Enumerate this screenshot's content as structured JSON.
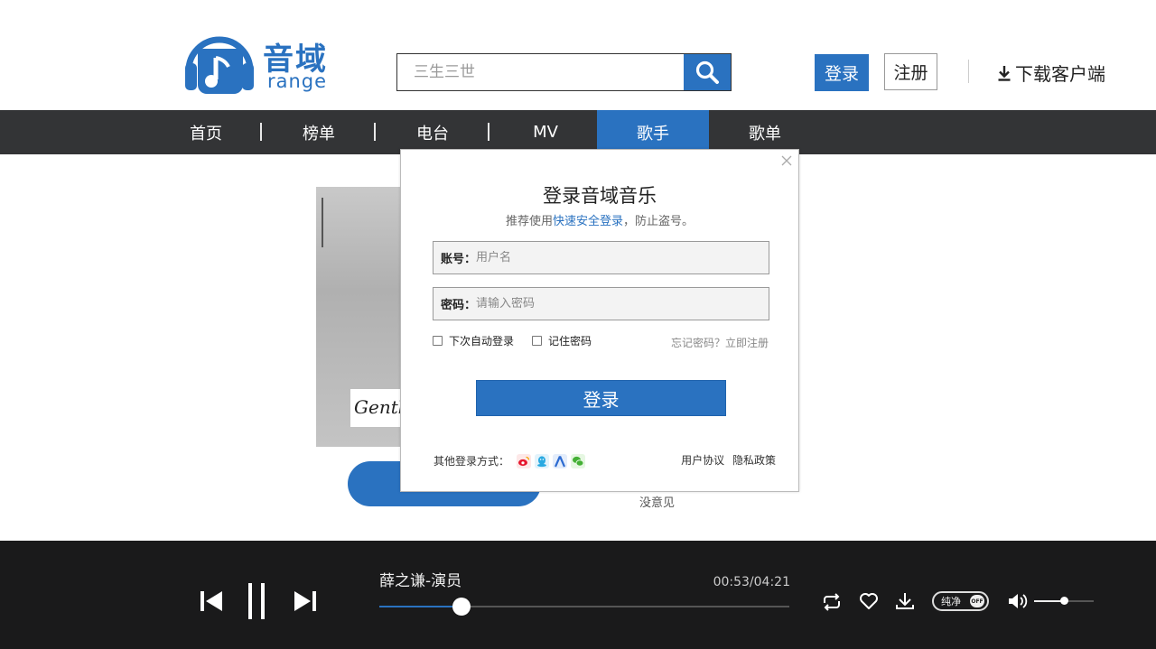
{
  "header": {
    "logo_name": "音域",
    "logo_sub": "range",
    "search_placeholder": "三生三世",
    "login_label": "登录",
    "register_label": "注册",
    "download_label": "下载客户端"
  },
  "nav": {
    "items": [
      "首页",
      "榜单",
      "电台",
      "MV",
      "歌手",
      "歌单"
    ],
    "active_index": 4
  },
  "background": {
    "album_label": "Gentle",
    "side_text": "没意见"
  },
  "login_modal": {
    "title": "登录音域音乐",
    "subtitle_prefix": "推荐使用",
    "subtitle_link": "快速安全登录",
    "subtitle_suffix": "，防止盗号。",
    "account_label": "账号：",
    "account_placeholder": "用户名",
    "password_label": "密码：",
    "password_placeholder": "请输入密码",
    "auto_login_label": "下次自动登录",
    "remember_label": "记住密码",
    "forgot_text": "忘记密码？立即注册",
    "submit_label": "登录",
    "other_login_label": "其他登录方式：",
    "social_icons": [
      "weibo-icon",
      "qq-icon",
      "renren-icon",
      "wechat-icon"
    ],
    "user_agreement": "用户协议",
    "privacy_policy": "隐私政策"
  },
  "player": {
    "song": "薛之谦-演员",
    "time": "00:53/04:21",
    "progress_fraction": 0.2,
    "pure_label": "纯净",
    "pure_state": "OFF",
    "volume_fraction": 0.5
  },
  "colors": {
    "accent": "#2a72c0",
    "nav_bg": "#333436",
    "player_bg": "#1a1a1b"
  }
}
